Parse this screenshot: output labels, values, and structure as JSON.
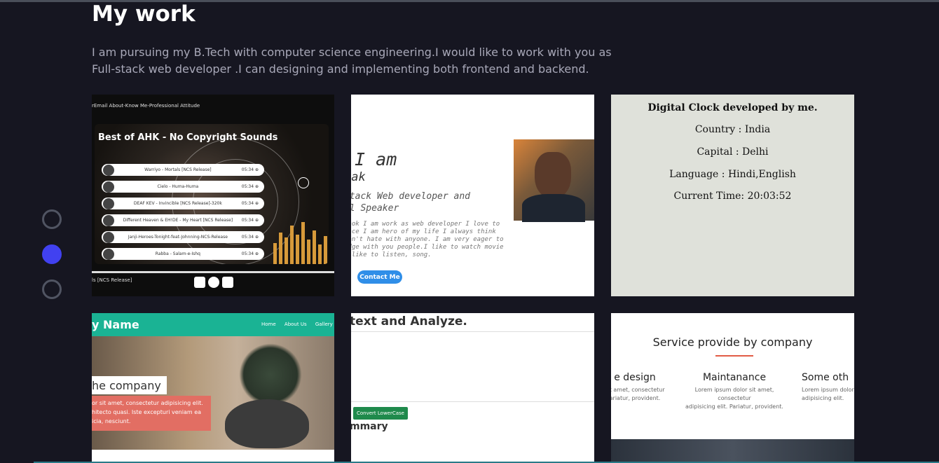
{
  "section": {
    "title": "My work",
    "description_line1": "I am pursuing my B.Tech with computer science engineering.I would like to work with you as",
    "description_line2": "Full-stack web developer .I can designing and implementing both frontend and backend."
  },
  "carousel": {
    "dots": [
      false,
      true,
      false
    ]
  },
  "cards": {
    "music": {
      "nav": "rEmail   About-Know Me-Professional Attitude",
      "title": "Best of AHK - No Copyright Sounds",
      "tracks": [
        {
          "name": "Warriyo - Mortals [NCS Release]",
          "time": "05:34 ⊕"
        },
        {
          "name": "Cielo - Huma-Huma",
          "time": "05:34 ⊕"
        },
        {
          "name": "DEAF KEV - Invincible [NCS Release]-320k",
          "time": "05:34 ⊕"
        },
        {
          "name": "Different Heaven & EH!DE - My Heart [NCS Release]",
          "time": "05:34 ⊕"
        },
        {
          "name": "Janji-Heroes-Tonight-feat-Johnning-NCS-Release",
          "time": "05:34 ⊕"
        },
        {
          "name": "Rabba - Salam-e-Ishq",
          "time": "05:34 ⊕"
        }
      ],
      "now_playing": "ls [NCS Release]"
    },
    "portfolio": {
      "greeting": ",I am",
      "name": "hak",
      "role_line1": "stack Web developer and",
      "role_line2": "al Speaker",
      "para_line1": "thok I am work as web developer I love to",
      "para_line2": "lace I am hero of my life I always think",
      "para_line3": "don't hate with anyone. I am very eager to",
      "para_line4": "edge with you people.I like to watch movie",
      "para_line5": "I like to listen, song.",
      "button": "Contact Me"
    },
    "clock": {
      "title": "Digital Clock developed by me.",
      "country": "Country : India",
      "capital": "Capital : Delhi",
      "language": "Language : Hindi,English",
      "time": "Current Time: 20:03:52"
    },
    "company": {
      "brand": "y Name",
      "menu": [
        "Home",
        "About Us",
        "Gallery"
      ],
      "tag": "he company",
      "red_line1": "or sit amet, consectetur adipisicing elit.",
      "red_line2": "hitecto quasi. Iste excepturi veniam ea",
      "red_line3": "icia, nesciunt."
    },
    "analyzer": {
      "heading": "text and Analyze.",
      "button": "Convert LowerCase",
      "summary": "mmary"
    },
    "services": {
      "heading": "Service provide by company",
      "columns": [
        {
          "title": "e design",
          "desc_line1": "sit amet, consectetur",
          "desc_line2": "ariatur, provident."
        },
        {
          "title": "Maintanance",
          "desc_line1": "Lorem ipsum dolor sit amet, consectetur",
          "desc_line2": "adipisicing elit. Pariatur, provident."
        },
        {
          "title": "Some oth",
          "desc_line1": "Lorem ipsum dolor",
          "desc_line2": "adipisicing elit."
        }
      ]
    }
  }
}
